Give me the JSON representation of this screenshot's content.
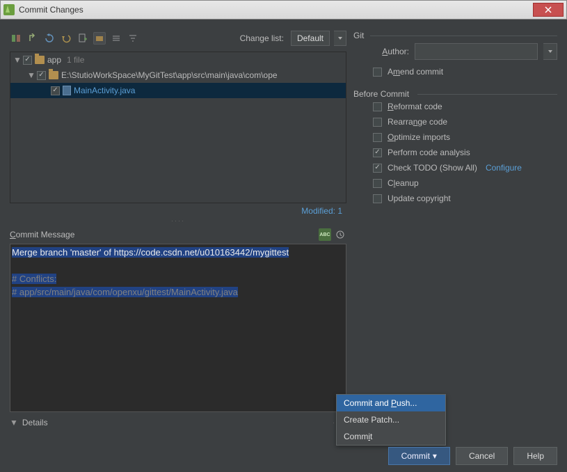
{
  "window": {
    "title": "Commit Changes"
  },
  "toolbar": {
    "change_list_label": "Change list:",
    "change_list_value": "Default"
  },
  "tree": {
    "root": {
      "label": "app",
      "hint": "1 file"
    },
    "path": {
      "label": "E:\\StutioWorkSpace\\MyGitTest\\app\\src\\main\\java\\com\\ope"
    },
    "file": {
      "label": "MainActivity.java"
    }
  },
  "modified": "Modified: 1",
  "commit_message_label": "Commit Message",
  "commit_message": {
    "line1": "Merge branch 'master' of https://code.csdn.net/u010163442/mygittest",
    "line3": "# Conflicts:",
    "line4": "#  app/src/main/java/com/openxu/gittest/MainActivity.java"
  },
  "details_label": "Details",
  "git": {
    "title": "Git",
    "author_label": "Author:",
    "amend_label": "Amend commit"
  },
  "before": {
    "title": "Before Commit",
    "reformat": "Reformat code",
    "rearrange": "Rearrange code",
    "optimize": "Optimize imports",
    "analysis": "Perform code analysis",
    "todo": "Check TODO (Show All)",
    "configure": "Configure",
    "cleanup": "Cleanup",
    "copyright": "Update copyright"
  },
  "popup": {
    "commit_push": "Commit and Push...",
    "create_patch": "Create Patch...",
    "commit": "Commit"
  },
  "buttons": {
    "commit": "Commit",
    "cancel": "Cancel",
    "help": "Help"
  }
}
